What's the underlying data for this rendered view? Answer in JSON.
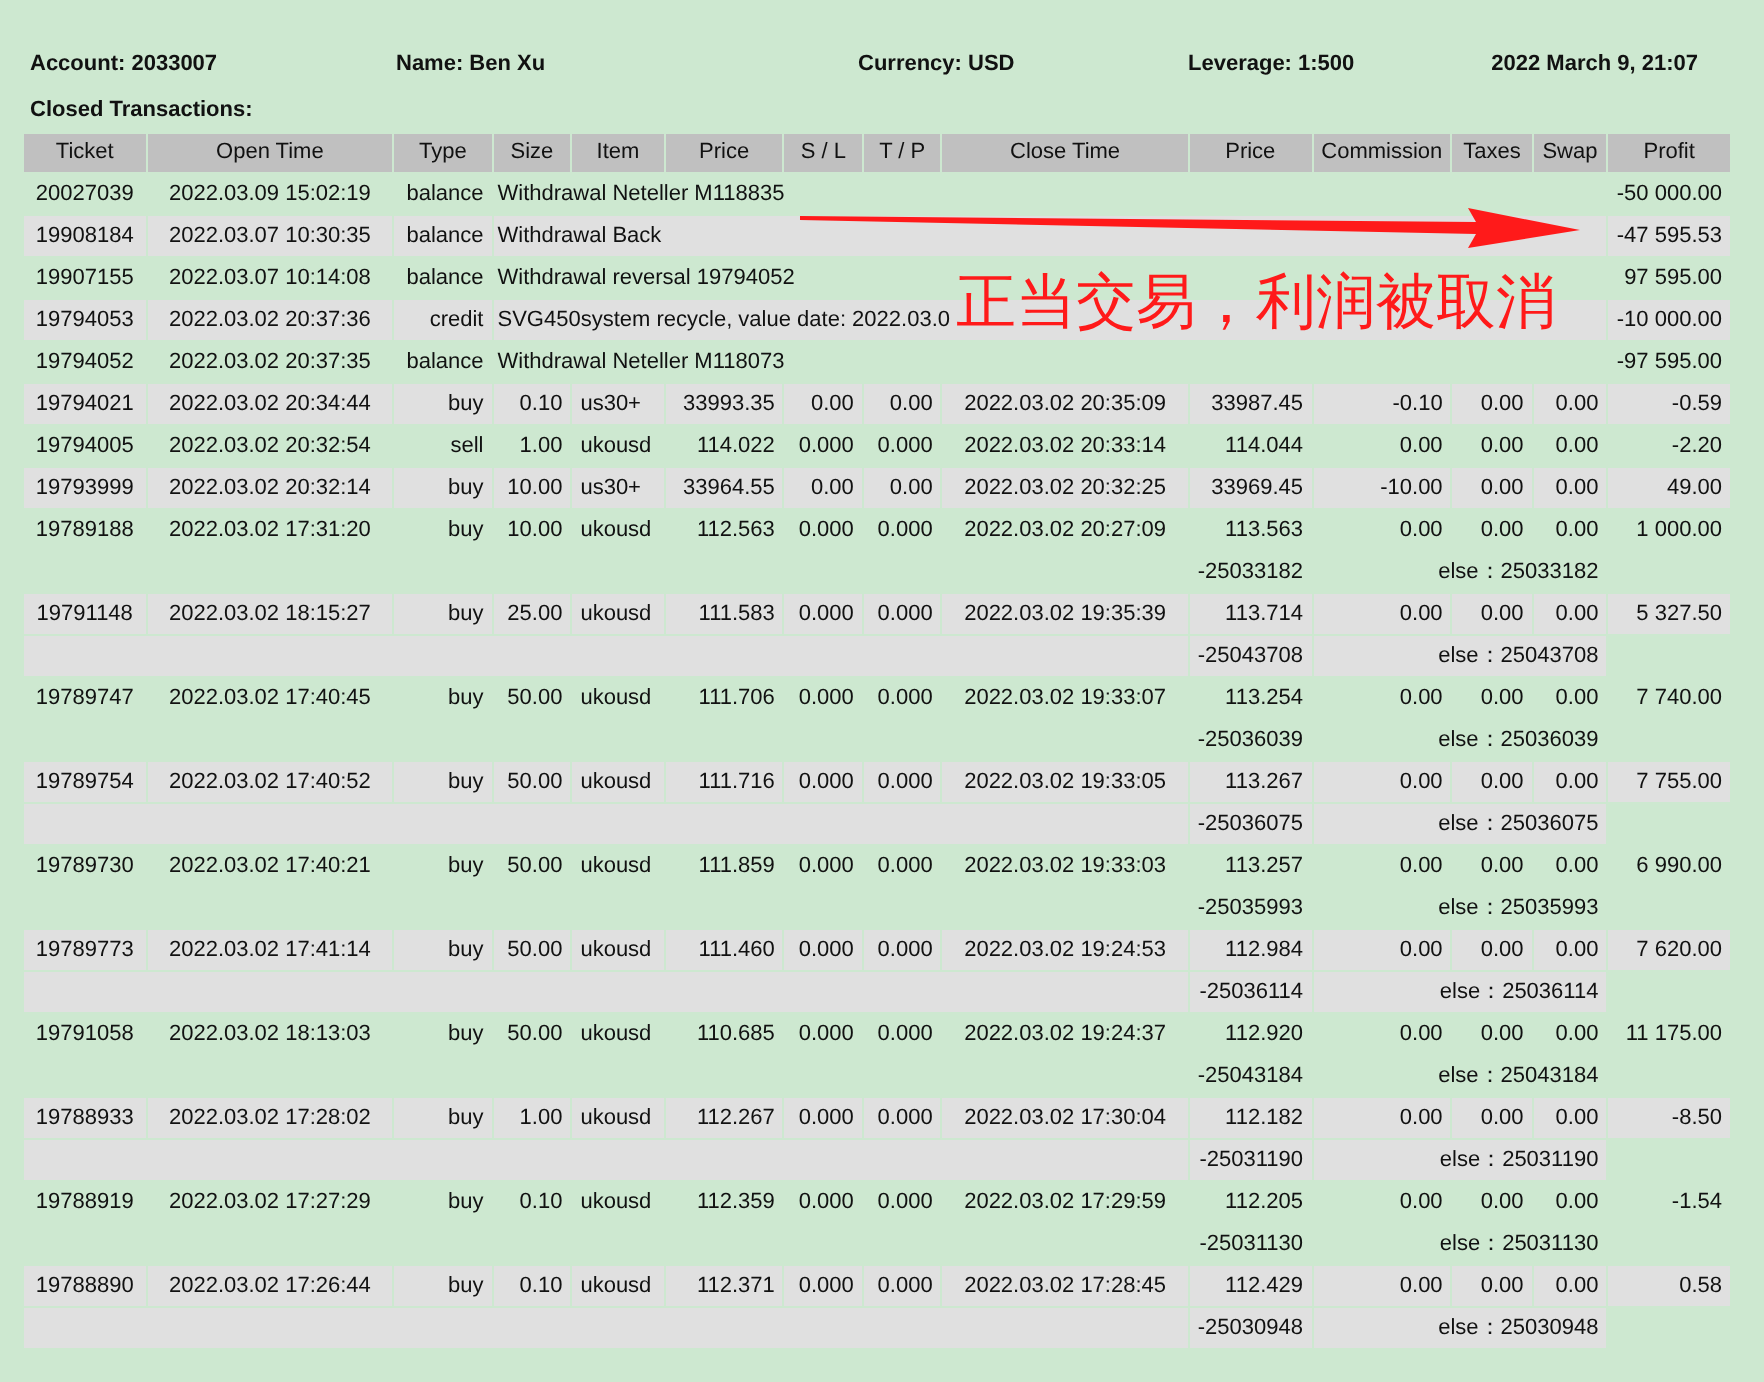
{
  "header": {
    "account": "Account: 2033007",
    "name": "Name: Ben Xu",
    "currency": "Currency: USD",
    "leverage": "Leverage: 1:500",
    "date": "2022 March 9, 21:07"
  },
  "section_title": "Closed Transactions:",
  "table": {
    "columns": [
      "Ticket",
      "Open Time",
      "Type",
      "Size",
      "Item",
      "Price",
      "S / L",
      "T / P",
      "Close Time",
      "Price",
      "Commission",
      "Taxes",
      "Swap",
      "Profit"
    ],
    "rows": [
      {
        "kind": "balance",
        "ticket": "20027039",
        "open_time": "2022.03.09 15:02:19",
        "type": "balance",
        "comment": "Withdrawal Neteller M118835",
        "profit": "-50 000.00"
      },
      {
        "kind": "balance",
        "ticket": "19908184",
        "open_time": "2022.03.07 10:30:35",
        "type": "balance",
        "comment": "Withdrawal Back",
        "profit": "-47 595.53"
      },
      {
        "kind": "balance",
        "ticket": "19907155",
        "open_time": "2022.03.07 10:14:08",
        "type": "balance",
        "comment": "Withdrawal reversal 19794052",
        "profit": "97 595.00"
      },
      {
        "kind": "balance",
        "ticket": "19794053",
        "open_time": "2022.03.02 20:37:36",
        "type": "credit",
        "comment": "SVG450system recycle, value date: 2022.03.0",
        "profit": "-10 000.00"
      },
      {
        "kind": "balance",
        "ticket": "19794052",
        "open_time": "2022.03.02 20:37:35",
        "type": "balance",
        "comment": "Withdrawal Neteller M118073",
        "profit": "-97 595.00"
      },
      {
        "kind": "trade",
        "ticket": "19794021",
        "open_time": "2022.03.02 20:34:44",
        "type": "buy",
        "size": "0.10",
        "item": "us30+",
        "price": "33993.35",
        "sl": "0.00",
        "tp": "0.00",
        "close_time": "2022.03.02 20:35:09",
        "close_price": "33987.45",
        "commission": "-0.10",
        "taxes": "0.00",
        "swap": "0.00",
        "profit": "-0.59"
      },
      {
        "kind": "trade",
        "ticket": "19794005",
        "open_time": "2022.03.02 20:32:54",
        "type": "sell",
        "size": "1.00",
        "item": "ukousd",
        "price": "114.022",
        "sl": "0.000",
        "tp": "0.000",
        "close_time": "2022.03.02 20:33:14",
        "close_price": "114.044",
        "commission": "0.00",
        "taxes": "0.00",
        "swap": "0.00",
        "profit": "-2.20"
      },
      {
        "kind": "trade",
        "ticket": "19793999",
        "open_time": "2022.03.02 20:32:14",
        "type": "buy",
        "size": "10.00",
        "item": "us30+",
        "price": "33964.55",
        "sl": "0.00",
        "tp": "0.00",
        "close_time": "2022.03.02 20:32:25",
        "close_price": "33969.45",
        "commission": "-10.00",
        "taxes": "0.00",
        "swap": "0.00",
        "profit": "49.00"
      },
      {
        "kind": "trade",
        "ticket": "19789188",
        "open_time": "2022.03.02 17:31:20",
        "type": "buy",
        "size": "10.00",
        "item": "ukousd",
        "price": "112.563",
        "sl": "0.000",
        "tp": "0.000",
        "close_time": "2022.03.02 20:27:09",
        "close_price": "113.563",
        "commission": "0.00",
        "taxes": "0.00",
        "swap": "0.00",
        "profit": "1 000.00",
        "ref": "-25033182",
        "note": "else：25033182"
      },
      {
        "kind": "trade",
        "ticket": "19791148",
        "open_time": "2022.03.02 18:15:27",
        "type": "buy",
        "size": "25.00",
        "item": "ukousd",
        "price": "111.583",
        "sl": "0.000",
        "tp": "0.000",
        "close_time": "2022.03.02 19:35:39",
        "close_price": "113.714",
        "commission": "0.00",
        "taxes": "0.00",
        "swap": "0.00",
        "profit": "5 327.50",
        "ref": "-25043708",
        "note": "else：25043708"
      },
      {
        "kind": "trade",
        "ticket": "19789747",
        "open_time": "2022.03.02 17:40:45",
        "type": "buy",
        "size": "50.00",
        "item": "ukousd",
        "price": "111.706",
        "sl": "0.000",
        "tp": "0.000",
        "close_time": "2022.03.02 19:33:07",
        "close_price": "113.254",
        "commission": "0.00",
        "taxes": "0.00",
        "swap": "0.00",
        "profit": "7 740.00",
        "ref": "-25036039",
        "note": "else：25036039"
      },
      {
        "kind": "trade",
        "ticket": "19789754",
        "open_time": "2022.03.02 17:40:52",
        "type": "buy",
        "size": "50.00",
        "item": "ukousd",
        "price": "111.716",
        "sl": "0.000",
        "tp": "0.000",
        "close_time": "2022.03.02 19:33:05",
        "close_price": "113.267",
        "commission": "0.00",
        "taxes": "0.00",
        "swap": "0.00",
        "profit": "7 755.00",
        "ref": "-25036075",
        "note": "else：25036075"
      },
      {
        "kind": "trade",
        "ticket": "19789730",
        "open_time": "2022.03.02 17:40:21",
        "type": "buy",
        "size": "50.00",
        "item": "ukousd",
        "price": "111.859",
        "sl": "0.000",
        "tp": "0.000",
        "close_time": "2022.03.02 19:33:03",
        "close_price": "113.257",
        "commission": "0.00",
        "taxes": "0.00",
        "swap": "0.00",
        "profit": "6 990.00",
        "ref": "-25035993",
        "note": "else：25035993"
      },
      {
        "kind": "trade",
        "ticket": "19789773",
        "open_time": "2022.03.02 17:41:14",
        "type": "buy",
        "size": "50.00",
        "item": "ukousd",
        "price": "111.460",
        "sl": "0.000",
        "tp": "0.000",
        "close_time": "2022.03.02 19:24:53",
        "close_price": "112.984",
        "commission": "0.00",
        "taxes": "0.00",
        "swap": "0.00",
        "profit": "7 620.00",
        "ref": "-25036114",
        "note": "else：25036114"
      },
      {
        "kind": "trade",
        "ticket": "19791058",
        "open_time": "2022.03.02 18:13:03",
        "type": "buy",
        "size": "50.00",
        "item": "ukousd",
        "price": "110.685",
        "sl": "0.000",
        "tp": "0.000",
        "close_time": "2022.03.02 19:24:37",
        "close_price": "112.920",
        "commission": "0.00",
        "taxes": "0.00",
        "swap": "0.00",
        "profit": "11 175.00",
        "ref": "-25043184",
        "note": "else：25043184"
      },
      {
        "kind": "trade",
        "ticket": "19788933",
        "open_time": "2022.03.02 17:28:02",
        "type": "buy",
        "size": "1.00",
        "item": "ukousd",
        "price": "112.267",
        "sl": "0.000",
        "tp": "0.000",
        "close_time": "2022.03.02 17:30:04",
        "close_price": "112.182",
        "commission": "0.00",
        "taxes": "0.00",
        "swap": "0.00",
        "profit": "-8.50",
        "ref": "-25031190",
        "note": "else：25031190"
      },
      {
        "kind": "trade",
        "ticket": "19788919",
        "open_time": "2022.03.02 17:27:29",
        "type": "buy",
        "size": "0.10",
        "item": "ukousd",
        "price": "112.359",
        "sl": "0.000",
        "tp": "0.000",
        "close_time": "2022.03.02 17:29:59",
        "close_price": "112.205",
        "commission": "0.00",
        "taxes": "0.00",
        "swap": "0.00",
        "profit": "-1.54",
        "ref": "-25031130",
        "note": "else：25031130"
      },
      {
        "kind": "trade",
        "ticket": "19788890",
        "open_time": "2022.03.02 17:26:44",
        "type": "buy",
        "size": "0.10",
        "item": "ukousd",
        "price": "112.371",
        "sl": "0.000",
        "tp": "0.000",
        "close_time": "2022.03.02 17:28:45",
        "close_price": "112.429",
        "commission": "0.00",
        "taxes": "0.00",
        "swap": "0.00",
        "profit": "0.58",
        "ref": "-25030948",
        "note": "else：25030948"
      }
    ]
  },
  "annotation": {
    "text": "正当交易，利润被取消"
  }
}
